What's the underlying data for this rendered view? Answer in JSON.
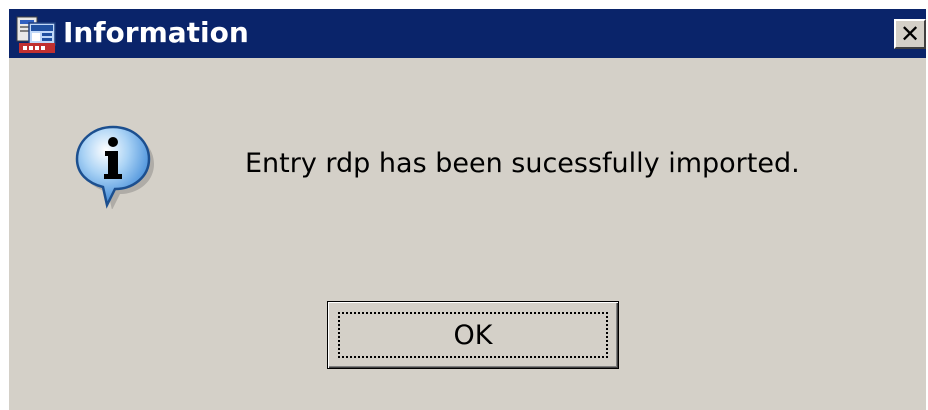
{
  "window": {
    "title": "Information",
    "close_label": "✕"
  },
  "message": {
    "text": "Entry rdp has been sucessfully imported."
  },
  "buttons": {
    "ok_label": "OK"
  },
  "icons": {
    "app": "app-icon",
    "info": "information-icon",
    "close": "close-icon"
  },
  "colors": {
    "titlebar": "#0a246a",
    "dialog_face": "#d4d0c8",
    "title_text": "#ffffff"
  }
}
